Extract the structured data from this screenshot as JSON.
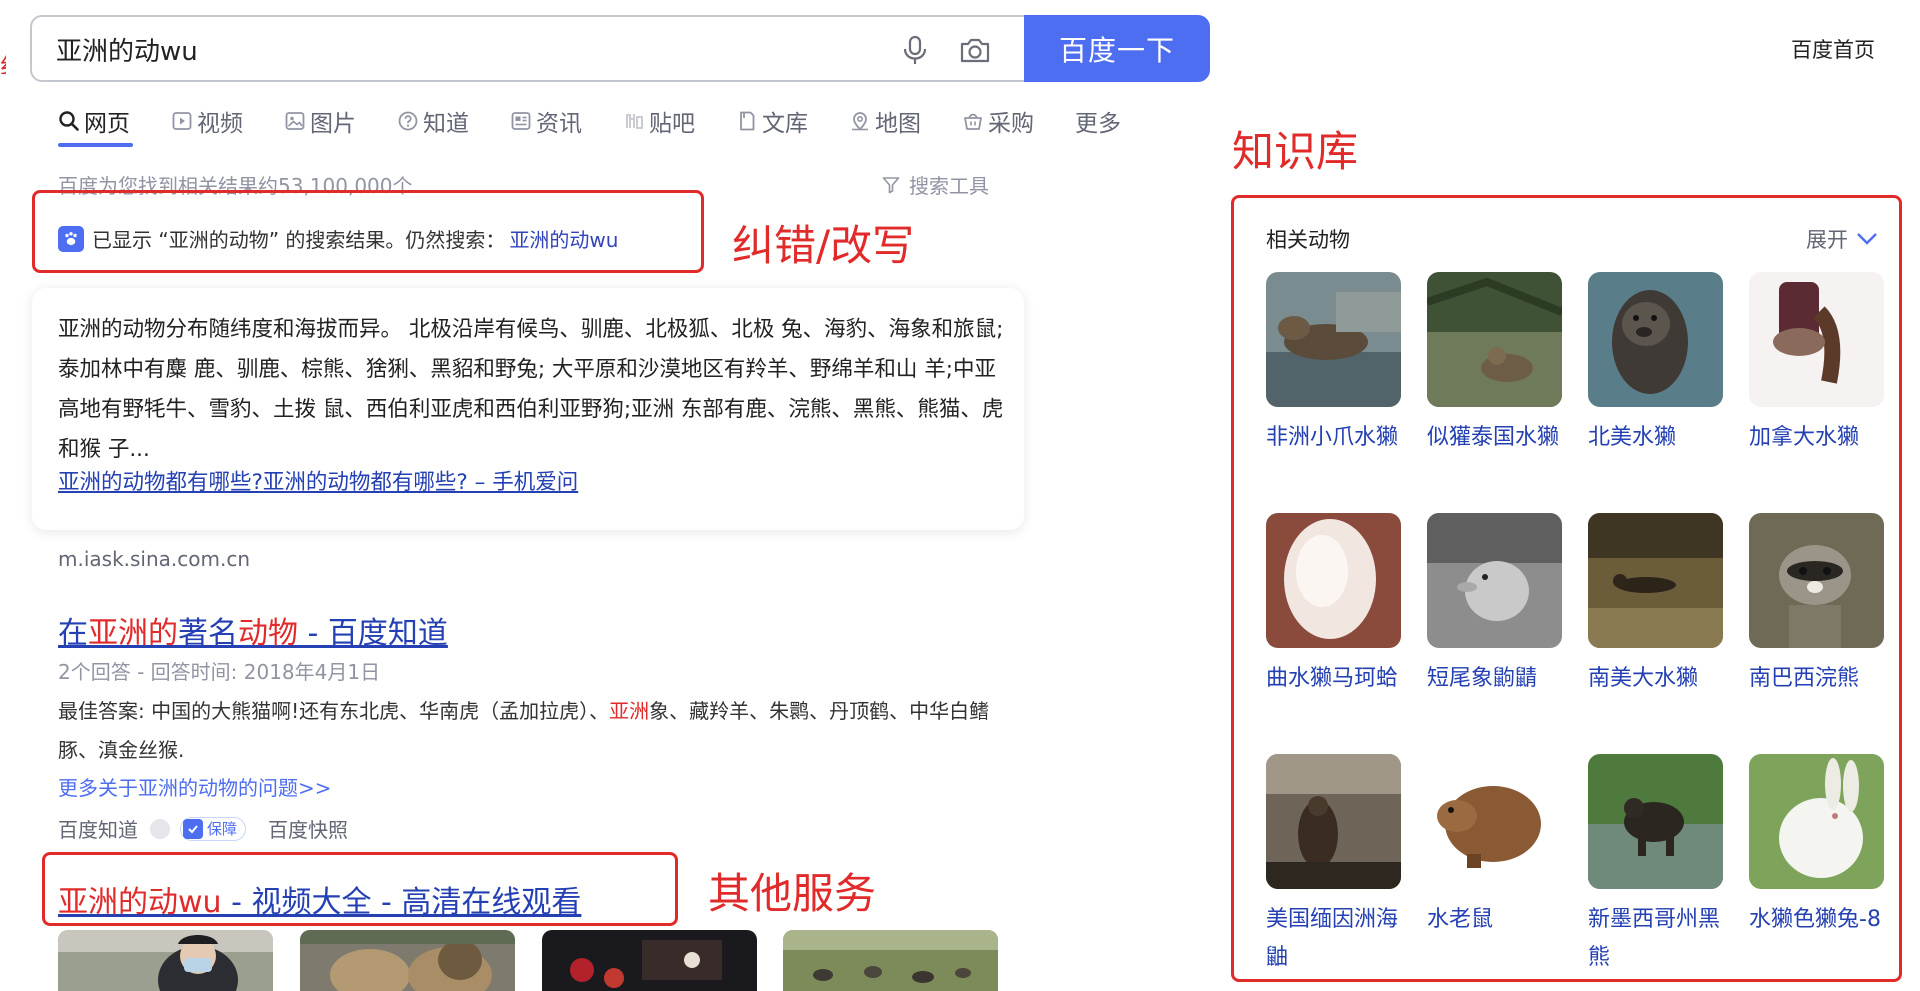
{
  "search": {
    "query": "亚洲的动wu",
    "button_label": "百度一下"
  },
  "header": {
    "home_link": "百度首页"
  },
  "nav": {
    "tabs": [
      {
        "label": "网页",
        "icon": "search-icon"
      },
      {
        "label": "视频",
        "icon": "video-icon"
      },
      {
        "label": "图片",
        "icon": "image-icon"
      },
      {
        "label": "知道",
        "icon": "question-icon"
      },
      {
        "label": "资讯",
        "icon": "news-icon"
      },
      {
        "label": "贴吧",
        "icon": "tieba-icon"
      },
      {
        "label": "文库",
        "icon": "document-icon"
      },
      {
        "label": "地图",
        "icon": "map-icon"
      },
      {
        "label": "采购",
        "icon": "basket-icon"
      },
      {
        "label": "更多",
        "icon": ""
      }
    ],
    "active_tab": "网页"
  },
  "results_info": {
    "count_text": "百度为您找到相关结果约53,100,000个",
    "tools_label": "搜索工具"
  },
  "correction": {
    "text": "已显示 “亚洲的动物” 的搜索结果。仍然搜索：",
    "link": "亚洲的动wu"
  },
  "answer_card": {
    "text": "亚洲的动物分布随纬度和海拔而异。 北极沿岸有候鸟、驯鹿、北极狐、北极 兔、海豹、海象和旅鼠;泰加林中有麋 鹿、驯鹿、棕熊、猞猁、黑貂和野兔; 大平原和沙漠地区有羚羊、野绵羊和山 羊;中亚高地有野牦牛、雪豹、土拨 鼠、西伯利亚虎和西伯利亚野狗;亚洲 东部有鹿、浣熊、黑熊、熊猫、虎和猴 子...",
    "link": "亚洲的动物都有哪些?亚洲的动物都有哪些? – 手机爱问",
    "source": "m.iask.sina.com.cn"
  },
  "result": {
    "title_parts": [
      "在",
      "亚洲的",
      "著名",
      "动物",
      " - 百度知道"
    ],
    "meta": "2个回答 - 回答时间: 2018年4月1日",
    "body_before": "最佳答案: 中国的大熊猫啊!还有东北虎、华南虎（孟加拉虎）、",
    "body_highlight": "亚洲",
    "body_after": "象、藏羚羊、朱鹮、丹顶鹤、中华白鳍豚、滇金丝猴.",
    "more_link": "更多关于亚洲的动物的问题>>",
    "footer_source": "百度知道",
    "badge": "保障",
    "snapshot": "百度快照"
  },
  "video_result": {
    "title_highlight": "亚洲的动wu",
    "title_rest": " - 视频大全 - 高清在线观看"
  },
  "annotations": {
    "correction": "纠错/改写",
    "knowledge": "知识库",
    "other_services": "其他服务"
  },
  "knowledge_panel": {
    "heading": "相关动物",
    "expand": "展开",
    "animals": [
      {
        "name": "非洲小爪水獭"
      },
      {
        "name": "似獾泰国水獭"
      },
      {
        "name": "北美水獭"
      },
      {
        "name": "加拿大水獭"
      },
      {
        "name": "曲水獭马珂蛤"
      },
      {
        "name": "短尾象鼩鼱"
      },
      {
        "name": "南美大水獭"
      },
      {
        "name": "南巴西浣熊"
      },
      {
        "name": "美国缅因洲海鼬"
      },
      {
        "name": "水老鼠"
      },
      {
        "name": "新墨西哥州黑熊"
      },
      {
        "name": "水獭色獭兔-8"
      }
    ]
  },
  "colors": {
    "brand_blue": "#4e6ef2",
    "link_blue": "#2440b3",
    "highlight_red": "#e12b2b",
    "annotation_red": "#e12b2b"
  }
}
